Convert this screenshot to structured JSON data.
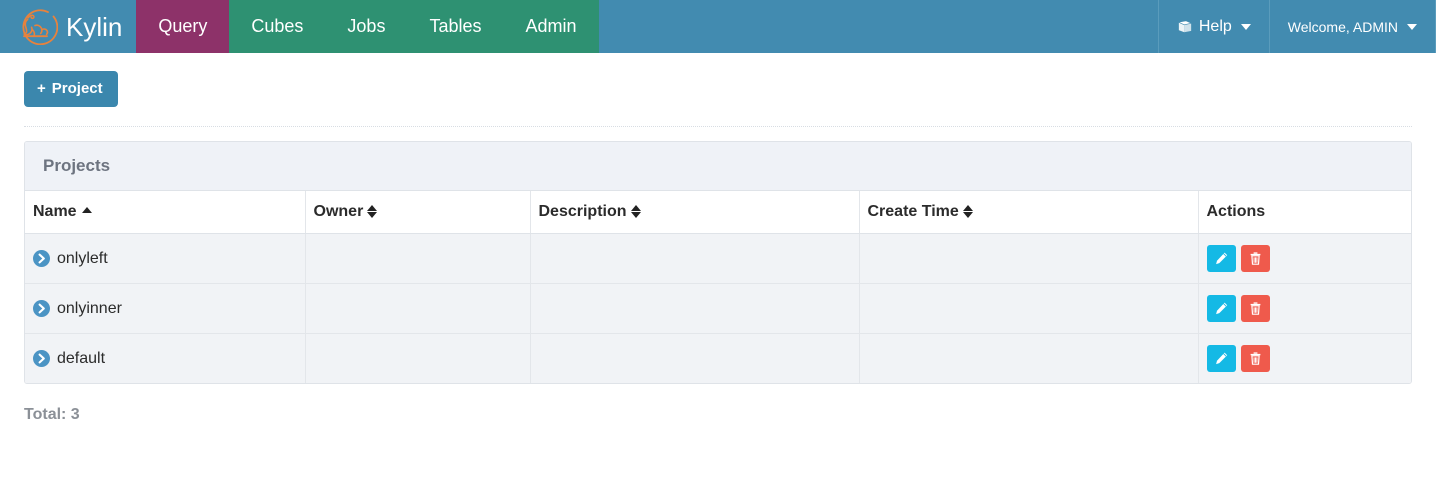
{
  "navbar": {
    "brand": {
      "name": "Kylin",
      "logo_icon": "kylin-logo-icon",
      "logo_color": "#e8823c"
    },
    "items": [
      {
        "label": "Query",
        "active": true
      },
      {
        "label": "Cubes",
        "active": false
      },
      {
        "label": "Jobs",
        "active": false
      },
      {
        "label": "Tables",
        "active": false
      },
      {
        "label": "Admin",
        "active": false
      }
    ],
    "right": {
      "help": {
        "label": "Help",
        "icon": "book-icon",
        "caret": "chevron-down-icon"
      },
      "user": {
        "label": "Welcome, ADMIN",
        "caret": "chevron-down-icon"
      }
    },
    "colors": {
      "bar": "#428bb0",
      "tab": "#2e9172",
      "active_tab": "#8d3269"
    }
  },
  "toolbar": {
    "project_button": {
      "label": "Project",
      "plus": "+",
      "icon": "plus-icon",
      "color": "#3b87ad"
    }
  },
  "panel": {
    "title": "Projects",
    "table": {
      "columns": [
        {
          "label": "Name",
          "sort": "asc",
          "sortable": true
        },
        {
          "label": "Owner",
          "sort": "both",
          "sortable": true
        },
        {
          "label": "Description",
          "sort": "both",
          "sortable": true
        },
        {
          "label": "Create Time",
          "sort": "both",
          "sortable": true
        },
        {
          "label": "Actions",
          "sort": "none",
          "sortable": false
        }
      ],
      "rows": [
        {
          "name": "onlyleft",
          "owner": "",
          "description": "",
          "create_time": "",
          "expand_icon": "chevron-right-circle-icon"
        },
        {
          "name": "onlyinner",
          "owner": "",
          "description": "",
          "create_time": "",
          "expand_icon": "chevron-right-circle-icon"
        },
        {
          "name": "default",
          "owner": "",
          "description": "",
          "create_time": "",
          "expand_icon": "chevron-right-circle-icon"
        }
      ],
      "actions": {
        "edit": {
          "icon": "pencil-icon",
          "color": "#14b9e5"
        },
        "delete": {
          "icon": "trash-icon",
          "color": "#ef5a4c"
        }
      }
    }
  },
  "footer": {
    "total": "Total: 3"
  }
}
